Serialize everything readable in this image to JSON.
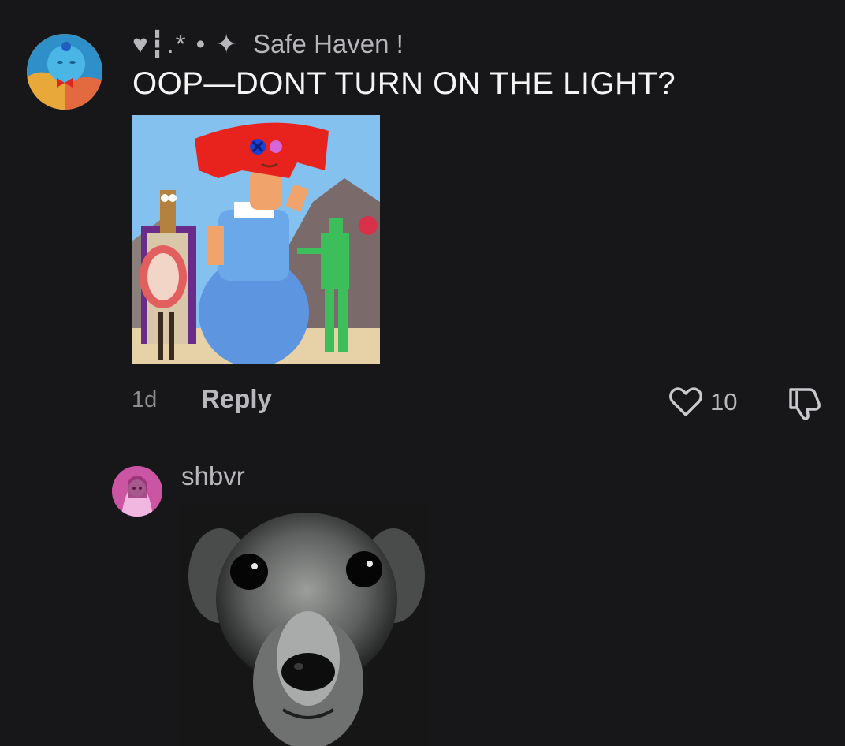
{
  "comments": [
    {
      "username_deco": "♥┇.* • ✦",
      "username": "Safe Haven !",
      "text": "OOP—DONT TURN ON THE LIGHT?",
      "timestamp": "1d",
      "reply_label": "Reply",
      "like_count": "10",
      "avatar_desc": "blue-character-avatar",
      "media": "cartoon-characters-image"
    },
    {
      "username": "shbvr",
      "avatar_desc": "pink-anime-avatar",
      "media": "dog-photo"
    }
  ],
  "icons": {
    "like": "heart-icon",
    "dislike": "thumbs-down-icon"
  },
  "colors": {
    "background": "#171719",
    "text_primary": "#f4f4f4",
    "text_secondary": "#b7b7bb",
    "text_muted": "#8d8d92"
  }
}
